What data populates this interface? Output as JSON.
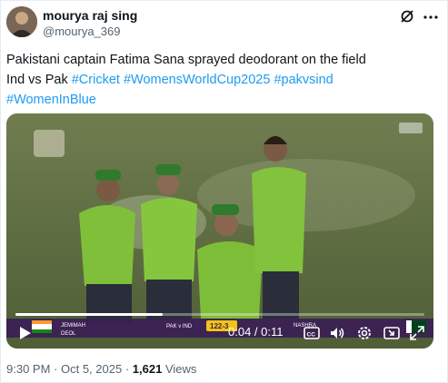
{
  "author": {
    "name": "mourya raj sing",
    "handle": "@mourya_369",
    "avatar_icon": "profile-photo"
  },
  "header_icons": [
    "grok-icon",
    "more-options-icon"
  ],
  "tweet": {
    "line1": "Pakistani captain Fatima Sana sprayed deodorant on the field",
    "line2_prefix": " Ind vs Pak ",
    "hashtags": [
      "#Cricket",
      "#WomensWorldCup2025",
      "#pakvsind",
      "#WomenInBlue"
    ]
  },
  "video": {
    "current_time": "0:04",
    "duration": "0:11",
    "progress": 0.36,
    "scorebar": {
      "player": "JEMIMAH",
      "player2": "DEOL",
      "match": "PAK v IND",
      "score": "122-3",
      "bowler": "NASHRA"
    },
    "controls": [
      "play-icon",
      "captions-icon",
      "volume-icon",
      "settings-icon",
      "pip-icon",
      "fullscreen-icon"
    ]
  },
  "meta": {
    "time": "9:30 PM",
    "date": "Oct 5, 2025",
    "views_count": "1,621",
    "views_label": "Views"
  },
  "colors": {
    "link": "#1d9bf0",
    "text": "#0f1419",
    "secondary": "#536471",
    "jersey": "#7fbf3a"
  }
}
